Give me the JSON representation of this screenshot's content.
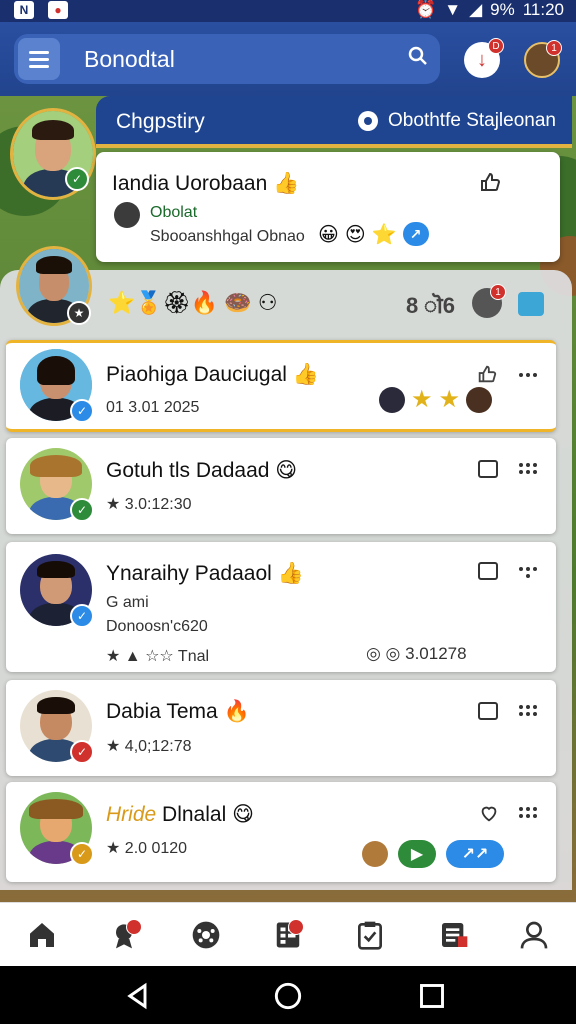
{
  "status_bar": {
    "time": "11:20",
    "battery": "9%"
  },
  "header": {
    "title": "Bonodtal",
    "notif_badge": "D",
    "profile_badge": "1"
  },
  "category": {
    "title": "Chgpstiry",
    "right_label": "Obothtfe Stajleonan"
  },
  "featured": {
    "name": "Iandia Uorobaan",
    "emoji": "👍",
    "sub_line1": "Obolat",
    "sub_line2": "Sbooanshhgal Obnao",
    "icons": [
      "😀",
      "😍",
      "⭐",
      "↗"
    ]
  },
  "panel": {
    "emoji_row": "⭐🏅🏵🔥 🍩 ⚇",
    "score": "8 ॊ6",
    "badge": "1"
  },
  "items": [
    {
      "title": "Piaohiga Dauciugal",
      "emoji": "👍",
      "line1": "01 3.01 2025",
      "line1_prefix_color": "#d97706"
    },
    {
      "title": "Gotuh tls Dadaad",
      "emoji": "😋",
      "line1": "★  3.0:12:30"
    },
    {
      "title": "Ynaraihy Padaaol",
      "emoji": "👍",
      "line1": "G ami",
      "line2": "Donoosn'c620",
      "line3_left": "★ ▲ ☆☆ Tnal",
      "line3_right": "◎  ◎ 3.01278"
    },
    {
      "title": "Dabia Tema",
      "emoji": "🔥",
      "line1": "★  4,0;12:78"
    },
    {
      "title": "Hride Dlnalal",
      "title_prefix": "Hride",
      "title_rest": "Dlnalal",
      "emoji": "😋",
      "line1": "★ 2.0 0120"
    }
  ],
  "nav": {
    "items": [
      "home-icon",
      "badge-icon",
      "game-icon",
      "list-icon",
      "clipboard-icon",
      "document-icon",
      "profile-icon"
    ]
  },
  "colors": {
    "header_blue": "#22448e",
    "accent_gold": "#f0b429",
    "verified_blue": "#2b8be6",
    "green": "#2e8b3a",
    "red": "#d0312d"
  }
}
